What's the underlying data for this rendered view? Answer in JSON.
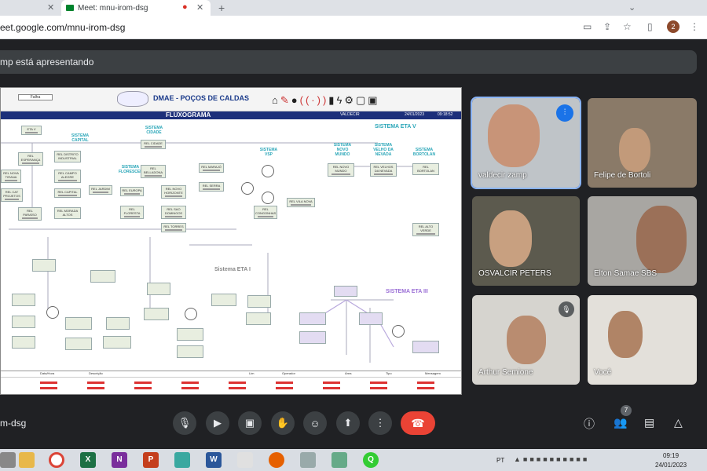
{
  "browser": {
    "tabs": [
      {
        "label": ""
      },
      {
        "label": "Meet: mnu-irom-dsg"
      }
    ],
    "url": "eet.google.com/mnu-irom-dsg",
    "profile_initial": "2"
  },
  "meet": {
    "presenting_text": "mp está apresentando",
    "meeting_code": "m-dsg",
    "participant_count": "7",
    "participants": [
      {
        "name": "valdecir zamp"
      },
      {
        "name": "Felipe de Bortoli"
      },
      {
        "name": "OSVALCIR PETERS"
      },
      {
        "name": "Elton Samae SBS"
      },
      {
        "name": "Arthur Semione"
      },
      {
        "name": "Você"
      }
    ]
  },
  "scada": {
    "title": "DMAE - POÇOS DE CALDAS",
    "tab_label": "Falha",
    "subtitle": "FLUXOGRAMA",
    "user": "VALDECIR",
    "date": "24/01/2023",
    "time": "09:18:52",
    "sistema_eta5": "SISTEMA ETA V",
    "sistema_eta1": "Sistema ETA I",
    "sistema_eta3": "SISTEMA ETA III",
    "labels": [
      "SISTEMA CIDADE",
      "SISTEMA CAPITAL",
      "SISTEMA FLORESCER",
      "SISTEMA VSP",
      "SISTEMA NOVO MUNDO",
      "SISTEMA VELHO DA NEVADA",
      "SISTEMA BORTOLAN"
    ],
    "nodes": [
      "ETA V",
      "REL CIDADE",
      "REL DISTRITO INDUSTRIAL",
      "REL CAMPO ALEGRE",
      "REL CAPITAL",
      "REL MORADA ALTOS",
      "REL ESPERANÇA",
      "REL NOVA TIRANA",
      "REL CAT PROJETOS",
      "REL PARAÍSO",
      "REL BELLADONA",
      "REL EUROPA",
      "REL FLORESTA",
      "REL JARDIM",
      "REL NOVO HORIZONTE",
      "REL MARAJÓ",
      "REL SAO DOMINGOS",
      "REL SERRA",
      "REL TORRES",
      "REL NOVO MUNDO",
      "REL VELHOS DA NEVADA",
      "REL BORTOLAN",
      "REL CONGONHAS",
      "REL VILA NOVA",
      "REL ALTO VERDE"
    ],
    "alarm_headers": [
      "Data/Hora",
      "Descrição",
      "Lim",
      "Operador",
      "Área",
      "Tipo",
      "Mensagem"
    ]
  }
}
